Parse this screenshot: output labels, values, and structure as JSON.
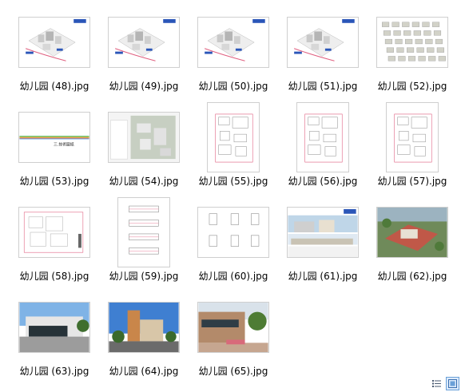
{
  "files": [
    {
      "name": "幼儿园 (48).jpg",
      "thumb": "iso-site-plan"
    },
    {
      "name": "幼儿园 (49).jpg",
      "thumb": "iso-site-plan"
    },
    {
      "name": "幼儿园 (50).jpg",
      "thumb": "iso-site-plan"
    },
    {
      "name": "幼儿园 (51).jpg",
      "thumb": "iso-site-plan"
    },
    {
      "name": "幼儿园 (52).jpg",
      "thumb": "massing-study"
    },
    {
      "name": "幼儿园 (53).jpg",
      "thumb": "cover-sheet",
      "cover_text": "三.技術圖紙"
    },
    {
      "name": "幼儿园 (54).jpg",
      "thumb": "site-aerial-drawing"
    },
    {
      "name": "幼儿园 (55).jpg",
      "thumb": "floor-plan"
    },
    {
      "name": "幼儿园 (56).jpg",
      "thumb": "floor-plan"
    },
    {
      "name": "幼儿园 (57).jpg",
      "thumb": "floor-plan"
    },
    {
      "name": "幼儿园 (58).jpg",
      "thumb": "roof-plan"
    },
    {
      "name": "幼儿园 (59).jpg",
      "thumb": "elevations"
    },
    {
      "name": "幼儿园 (60).jpg",
      "thumb": "sections"
    },
    {
      "name": "幼儿园 (61).jpg",
      "thumb": "elevation-render"
    },
    {
      "name": "幼儿园 (62).jpg",
      "thumb": "aerial-render"
    },
    {
      "name": "幼儿园 (63).jpg",
      "thumb": "street-render"
    },
    {
      "name": "幼儿园 (64).jpg",
      "thumb": "tower-render"
    },
    {
      "name": "幼儿园 (65).jpg",
      "thumb": "courtyard-render"
    }
  ],
  "view_controls": {
    "details_view": "details-view-icon",
    "thumbnails_view": "large-icons-view-icon",
    "active": "thumbnails_view"
  },
  "colors": {
    "selection_border": "#6aa0d8",
    "selection_fill": "#dceafb",
    "drawing_blue": "#2b56b8",
    "drawing_red": "#e06080"
  }
}
